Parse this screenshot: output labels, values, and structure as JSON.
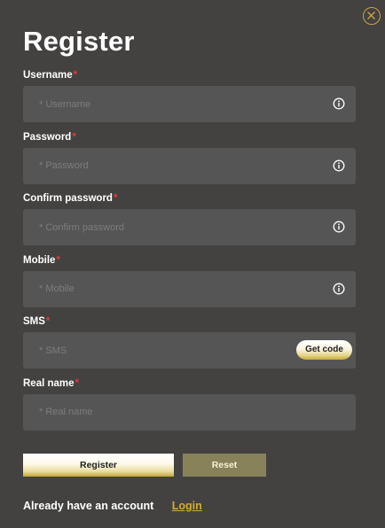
{
  "title": "Register",
  "required_mark": "*",
  "fields": [
    {
      "label": "Username",
      "placeholder": "* Username"
    },
    {
      "label": "Password",
      "placeholder": "* Password"
    },
    {
      "label": "Confirm password",
      "placeholder": "* Confirm password"
    },
    {
      "label": "Mobile",
      "placeholder": "* Mobile"
    },
    {
      "label": "SMS",
      "placeholder": "* SMS"
    },
    {
      "label": "Real name",
      "placeholder": "* Real name"
    }
  ],
  "get_code_label": "Get code",
  "buttons": {
    "register": "Register",
    "reset": "Reset"
  },
  "footer": {
    "text": "Already have an account",
    "login": "Login"
  },
  "colors": {
    "background": "#434241",
    "input_background": "#555555",
    "accent_gold": "#c9a24a",
    "required_red": "#e23b3b",
    "reset_button": "#87825a"
  },
  "icons": {
    "close": "close-icon",
    "info": "info-icon"
  }
}
